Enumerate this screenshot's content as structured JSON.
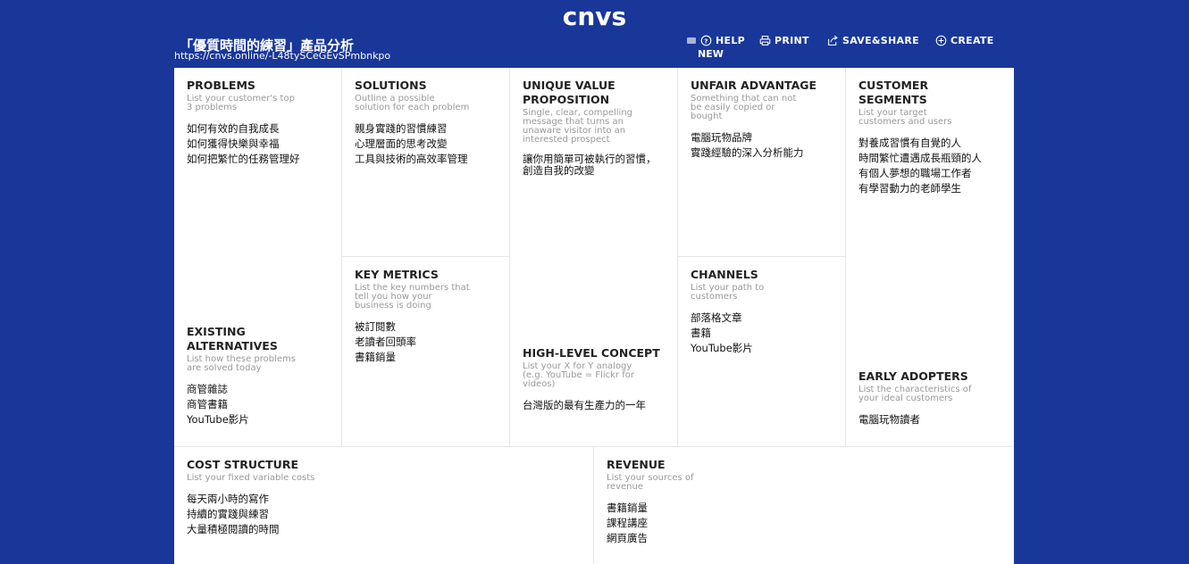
{
  "header": {
    "logo": "cnvs",
    "doc_title": "「優質時間的練習」產品分析",
    "doc_url": "https://cnvs.online/-L48tySCeGEvSPmbnkpo",
    "nav": {
      "help": "HELP",
      "new": "NEW",
      "print": "PRINT",
      "save_share": "SAVE&SHARE",
      "create": "CREATE"
    }
  },
  "canvas": {
    "problems": {
      "title": "PROBLEMS",
      "desc": "List your customer's top 3 problems",
      "items": [
        "如何有效的自我成長",
        "如何獲得快樂與幸福",
        "如何把繁忙的任務管理好"
      ]
    },
    "existing_alternatives": {
      "title": "EXISTING ALTERNATIVES",
      "desc": "List how these problems are solved today",
      "items": [
        "商管雜誌",
        "商管書籍",
        "YouTube影片"
      ]
    },
    "solutions": {
      "title": "SOLUTIONS",
      "desc": "Outline a possible solution for each problem",
      "items": [
        "親身實踐的習慣練習",
        "心理層面的思考改變",
        "工具與技術的高效率管理"
      ]
    },
    "key_metrics": {
      "title": "KEY METRICS",
      "desc": "List the key numbers that tell you how your business is doing",
      "items": [
        "被訂閱數",
        "老讀者回頭率",
        "書籍銷量"
      ]
    },
    "uvp": {
      "title": "UNIQUE VALUE PROPOSITION",
      "desc": "Single, clear, compelling message that turns an unaware visitor into an interested prospect",
      "items": [
        "讓你用簡單可被執行的習慣，創造自我的改變"
      ]
    },
    "high_level_concept": {
      "title": "HIGH-LEVEL CONCEPT",
      "desc": "List your X for Y analogy (e.g. YouTube = Flickr for videos)",
      "items": [
        "台灣版的最有生產力的一年"
      ]
    },
    "unfair_advantage": {
      "title": "UNFAIR ADVANTAGE",
      "desc": "Something that can not be easily copied or bought",
      "items": [
        "電腦玩物品牌",
        "實踐經驗的深入分析能力"
      ]
    },
    "channels": {
      "title": "CHANNELS",
      "desc": "List your path to customers",
      "items": [
        "部落格文章",
        "書籍",
        "YouTube影片"
      ]
    },
    "customer_segments": {
      "title": "CUSTOMER SEGMENTS",
      "desc": "List your target customers and users",
      "items": [
        "對養成習慣有自覺的人",
        "時間繁忙遭遇成長瓶頸的人",
        "有個人夢想的職場工作者",
        "有學習動力的老師學生"
      ]
    },
    "early_adopters": {
      "title": "EARLY ADOPTERS",
      "desc": "List the characteristics of your ideal customers",
      "items": [
        "電腦玩物讀者"
      ]
    },
    "cost_structure": {
      "title": "COST STRUCTURE",
      "desc": "List your fixed variable costs",
      "items": [
        "每天兩小時的寫作",
        "持續的實踐與練習",
        "大量積極閱讀的時間"
      ]
    },
    "revenue": {
      "title": "REVENUE",
      "desc": "List your sources of revenue",
      "items": [
        "書籍銷量",
        "課程講座",
        "網頁廣告"
      ]
    }
  }
}
